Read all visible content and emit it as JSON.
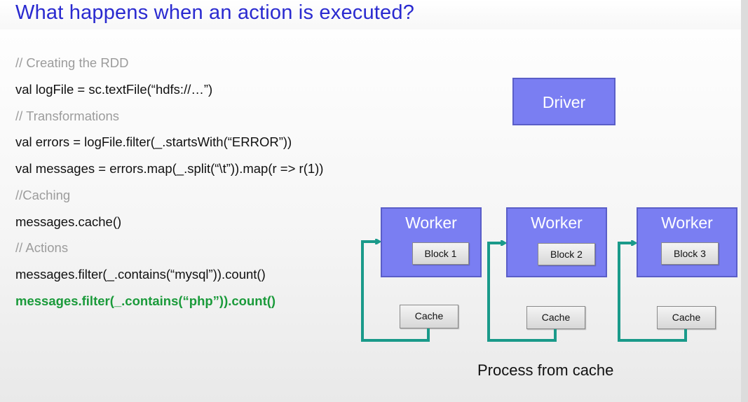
{
  "title": "What happens when an action is executed?",
  "code": [
    {
      "text": "// Creating the RDD",
      "kind": "comment"
    },
    {
      "text": "val logFile = sc.textFile(“hdfs://…”)",
      "kind": "code"
    },
    {
      "text": "// Transformations",
      "kind": "comment"
    },
    {
      "text": "val errors = logFile.filter(_.startsWith(“ERROR”))",
      "kind": "code"
    },
    {
      "text": "val messages = errors.map(_.split(“\\t”)).map(r => r(1))",
      "kind": "code"
    },
    {
      "text": "//Caching",
      "kind": "comment"
    },
    {
      "text": "messages.cache()",
      "kind": "code"
    },
    {
      "text": "// Actions",
      "kind": "comment"
    },
    {
      "text": "messages.filter(_.contains(“mysql”)).count()",
      "kind": "code"
    },
    {
      "text": "messages.filter(_.contains(“php”)).count()",
      "kind": "highlight"
    }
  ],
  "diagram": {
    "driver_label": "Driver",
    "workers": [
      {
        "label": "Worker",
        "block": "Block 1",
        "cache": "Cache"
      },
      {
        "label": "Worker",
        "block": "Block 2",
        "cache": "Cache"
      },
      {
        "label": "Worker",
        "block": "Block 3",
        "cache": "Cache"
      }
    ],
    "caption": "Process from cache"
  },
  "colors": {
    "title": "#2a2ad0",
    "box_fill": "#7a7ef2",
    "arrow": "#1a9a8a",
    "highlight_code": "#1a9a3a",
    "comment": "#9c9c9c"
  }
}
